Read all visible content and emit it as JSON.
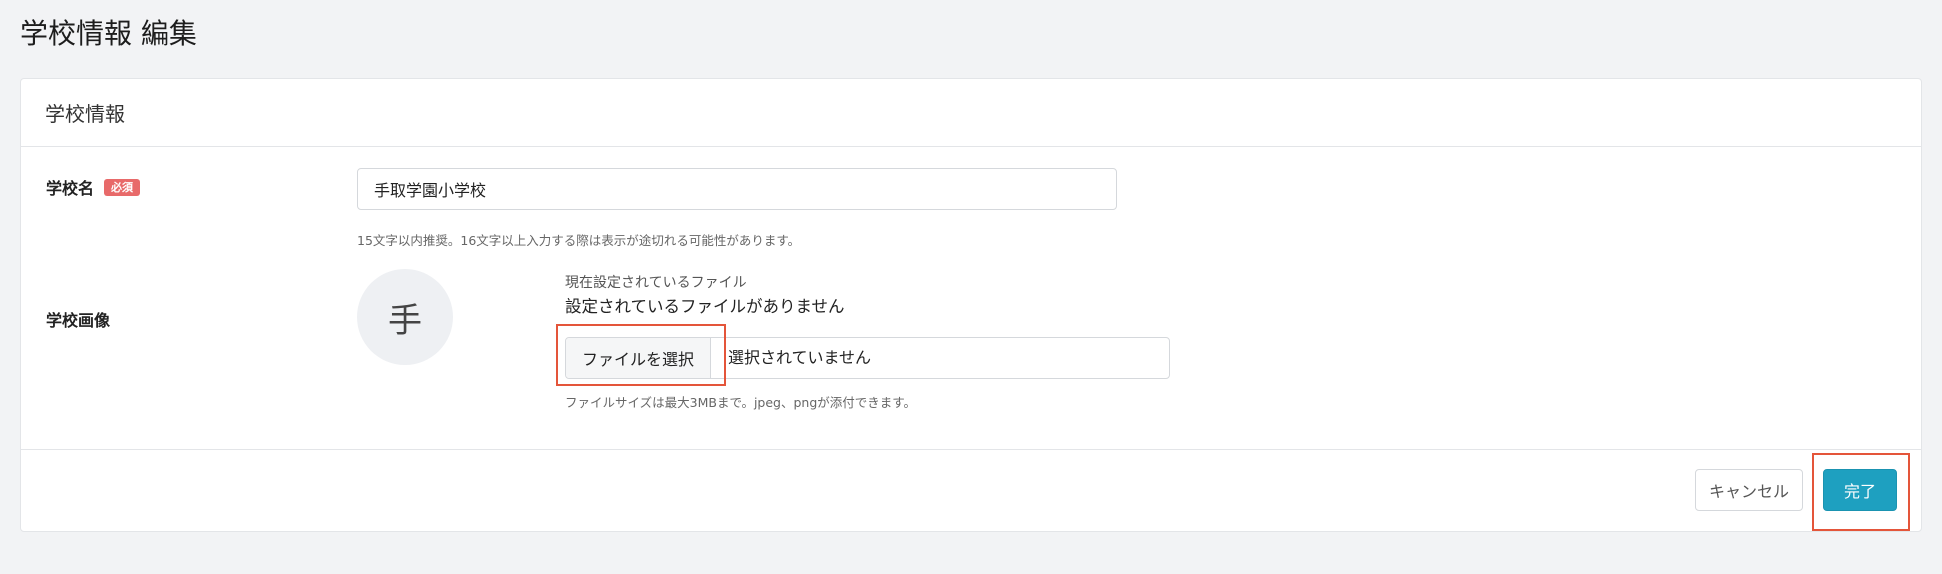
{
  "page": {
    "title": "学校情報 編集"
  },
  "card": {
    "header_title": "学校情報"
  },
  "school_name": {
    "label": "学校名",
    "required_badge": "必須",
    "value": "手取学園小学校",
    "hint": "15文字以内推奨。16文字以上入力する際は表示が途切れる可能性があります。"
  },
  "school_image": {
    "label": "学校画像",
    "avatar_initial": "手",
    "current_file_label": "現在設定されているファイル",
    "current_file_value": "設定されているファイルがありません",
    "choose_file_button": "ファイルを選択",
    "file_status": "選択されていません",
    "hint": "ファイルサイズは最大3MBまで。jpeg、pngが添付できます。"
  },
  "actions": {
    "cancel_label": "キャンセル",
    "done_label": "完了"
  },
  "colors": {
    "background": "#f2f3f5",
    "required_badge": "#e86a6a",
    "primary_button": "#1ea0c0",
    "highlight": "#e4553a"
  }
}
